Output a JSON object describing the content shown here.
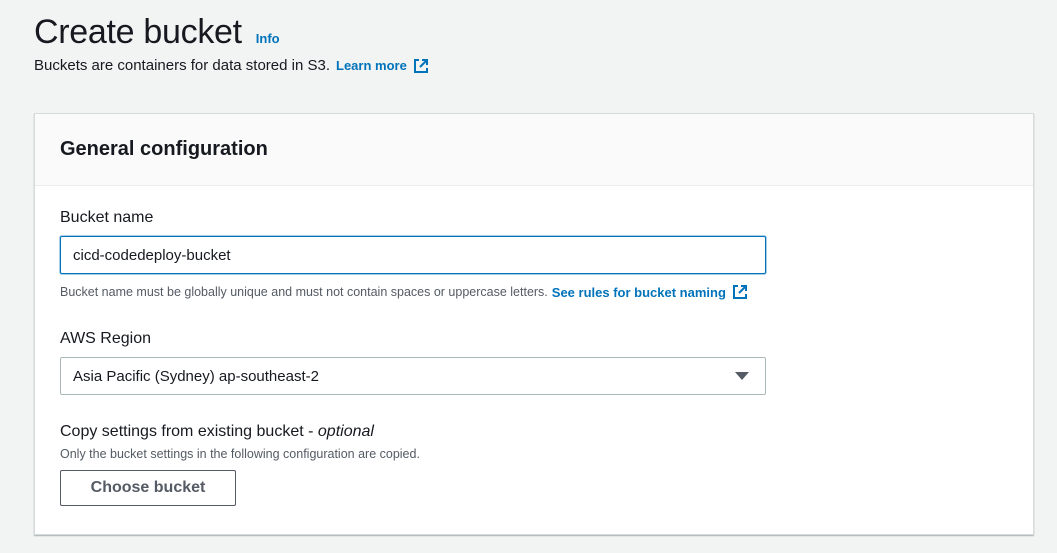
{
  "header": {
    "title": "Create bucket",
    "info_link": "Info",
    "description": "Buckets are containers for data stored in S3.",
    "learn_more_link": "Learn more"
  },
  "general_config": {
    "title": "General configuration",
    "bucket_name": {
      "label": "Bucket name",
      "value": "cicd-codedeploy-bucket",
      "hint": "Bucket name must be globally unique and must not contain spaces or uppercase letters.",
      "rules_link": "See rules for bucket naming"
    },
    "region": {
      "label": "AWS Region",
      "selected": "Asia Pacific (Sydney) ap-southeast-2"
    },
    "copy_settings": {
      "label": "Copy settings from existing bucket",
      "separator": " - ",
      "optional": "optional",
      "description": "Only the bucket settings in the following configuration are copied.",
      "button": "Choose bucket"
    }
  },
  "colors": {
    "link": "#0073bb",
    "background": "#f2f3f3",
    "text": "#16191f",
    "secondary_text": "#545b64"
  },
  "icons": {
    "external_link": "external-link-icon",
    "dropdown": "caret-down-icon"
  }
}
